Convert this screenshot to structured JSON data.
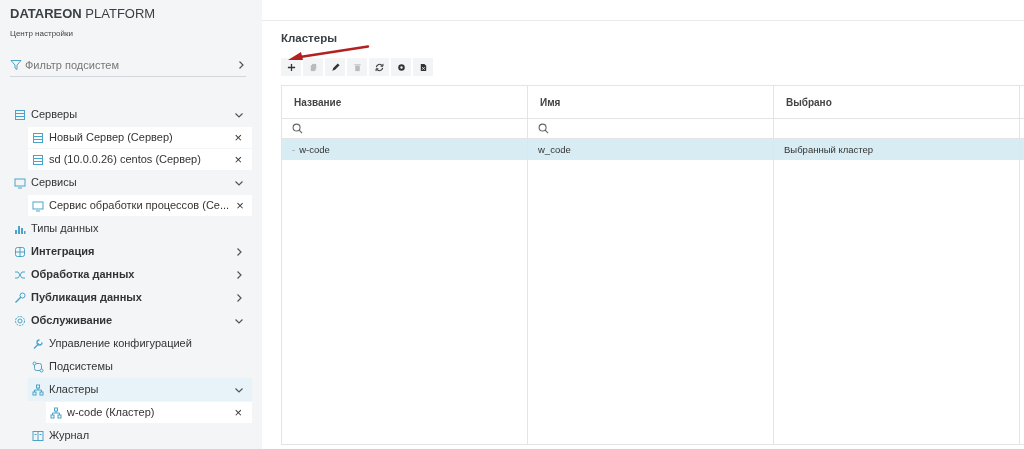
{
  "brand": {
    "name_bold": "DATAREON",
    "name_rest": "PLATFORM",
    "subtitle": "Центр настройки"
  },
  "filter": {
    "label": "Фильтр подсистем"
  },
  "sidebar": {
    "items": [
      {
        "kind": "folder",
        "label": "Серверы",
        "expanded": true,
        "selected": false,
        "children": [
          {
            "kind": "open",
            "label": "Новый Сервер (Сервер)",
            "close": "×",
            "selected": false
          },
          {
            "kind": "open",
            "label": "sd (10.0.0.26) centos (Сервер)",
            "close": "×",
            "selected": false
          }
        ]
      },
      {
        "kind": "folder",
        "label": "Сервисы",
        "expanded": true,
        "selected": false,
        "children": [
          {
            "kind": "open",
            "label": "Сервис обработки процессов (Се...",
            "close": "×",
            "selected": false
          }
        ]
      },
      {
        "kind": "link",
        "label": "Типы данных",
        "selected": false
      },
      {
        "kind": "module",
        "label": "Интеграция",
        "expanded": false,
        "selected": false
      },
      {
        "kind": "module",
        "label": "Обработка данных",
        "expanded": false,
        "selected": false
      },
      {
        "kind": "module",
        "label": "Публикация данных",
        "expanded": false,
        "selected": false
      },
      {
        "kind": "module",
        "label": "Обслуживание",
        "expanded": true,
        "selected": false,
        "children": [
          {
            "kind": "link",
            "label": "Управление конфигурацией",
            "selected": false
          },
          {
            "kind": "link",
            "label": "Подсистемы",
            "selected": false
          },
          {
            "kind": "folder",
            "label": "Кластеры",
            "expanded": true,
            "selected": true,
            "children": [
              {
                "kind": "open",
                "label": "w-code (Кластер)",
                "close": "×",
                "selected": false
              }
            ]
          },
          {
            "kind": "link",
            "label": "Журнал",
            "selected": false
          }
        ]
      }
    ]
  },
  "page": {
    "title": "Кластеры"
  },
  "toolbar": [
    {
      "kind": "add",
      "disabled": false
    },
    {
      "kind": "copy",
      "disabled": true
    },
    {
      "kind": "edit",
      "disabled": false
    },
    {
      "kind": "delete",
      "disabled": true
    },
    {
      "kind": "refresh",
      "disabled": false
    },
    {
      "kind": "settings",
      "disabled": false
    },
    {
      "kind": "export",
      "disabled": false
    }
  ],
  "table": {
    "columns": [
      "Название",
      "Имя",
      "Выбрано"
    ],
    "filters": [
      true,
      true,
      false
    ],
    "rows": [
      {
        "toggle": "-",
        "cells": [
          "w-code",
          "w_code",
          "Выбранный кластер"
        ],
        "selected": true
      }
    ]
  },
  "annotation": {
    "kind": "arrow"
  }
}
